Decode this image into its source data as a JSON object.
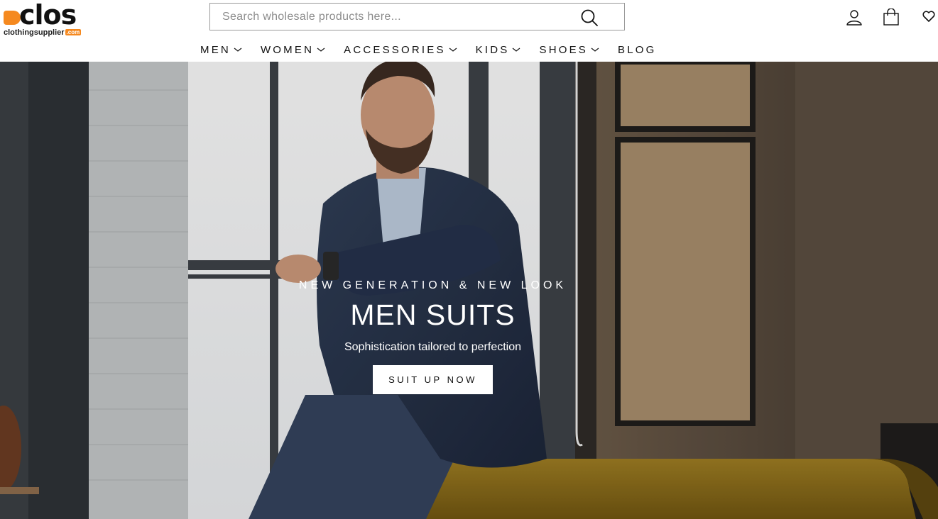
{
  "brand": {
    "name": "clos",
    "tagline": "clothingsupplier",
    "tagline_suffix": ".com",
    "accent_color": "#f5891f"
  },
  "search": {
    "placeholder": "Search wholesale products here...",
    "value": "",
    "icon": "search-icon"
  },
  "header_icons": [
    {
      "name": "account-icon"
    },
    {
      "name": "cart-icon"
    },
    {
      "name": "wishlist-icon"
    }
  ],
  "nav": {
    "items": [
      {
        "label": "MEN",
        "has_dropdown": true
      },
      {
        "label": "WOMEN",
        "has_dropdown": true
      },
      {
        "label": "ACCESSORIES",
        "has_dropdown": true
      },
      {
        "label": "KIDS",
        "has_dropdown": true
      },
      {
        "label": "SHOES",
        "has_dropdown": true
      },
      {
        "label": "BLOG",
        "has_dropdown": false
      }
    ]
  },
  "hero": {
    "eyebrow": "NEW GENERATION & NEW LOOK",
    "title": "MEN SUITS",
    "subtitle": "Sophistication tailored to perfection",
    "cta_label": "SUIT UP NOW"
  }
}
